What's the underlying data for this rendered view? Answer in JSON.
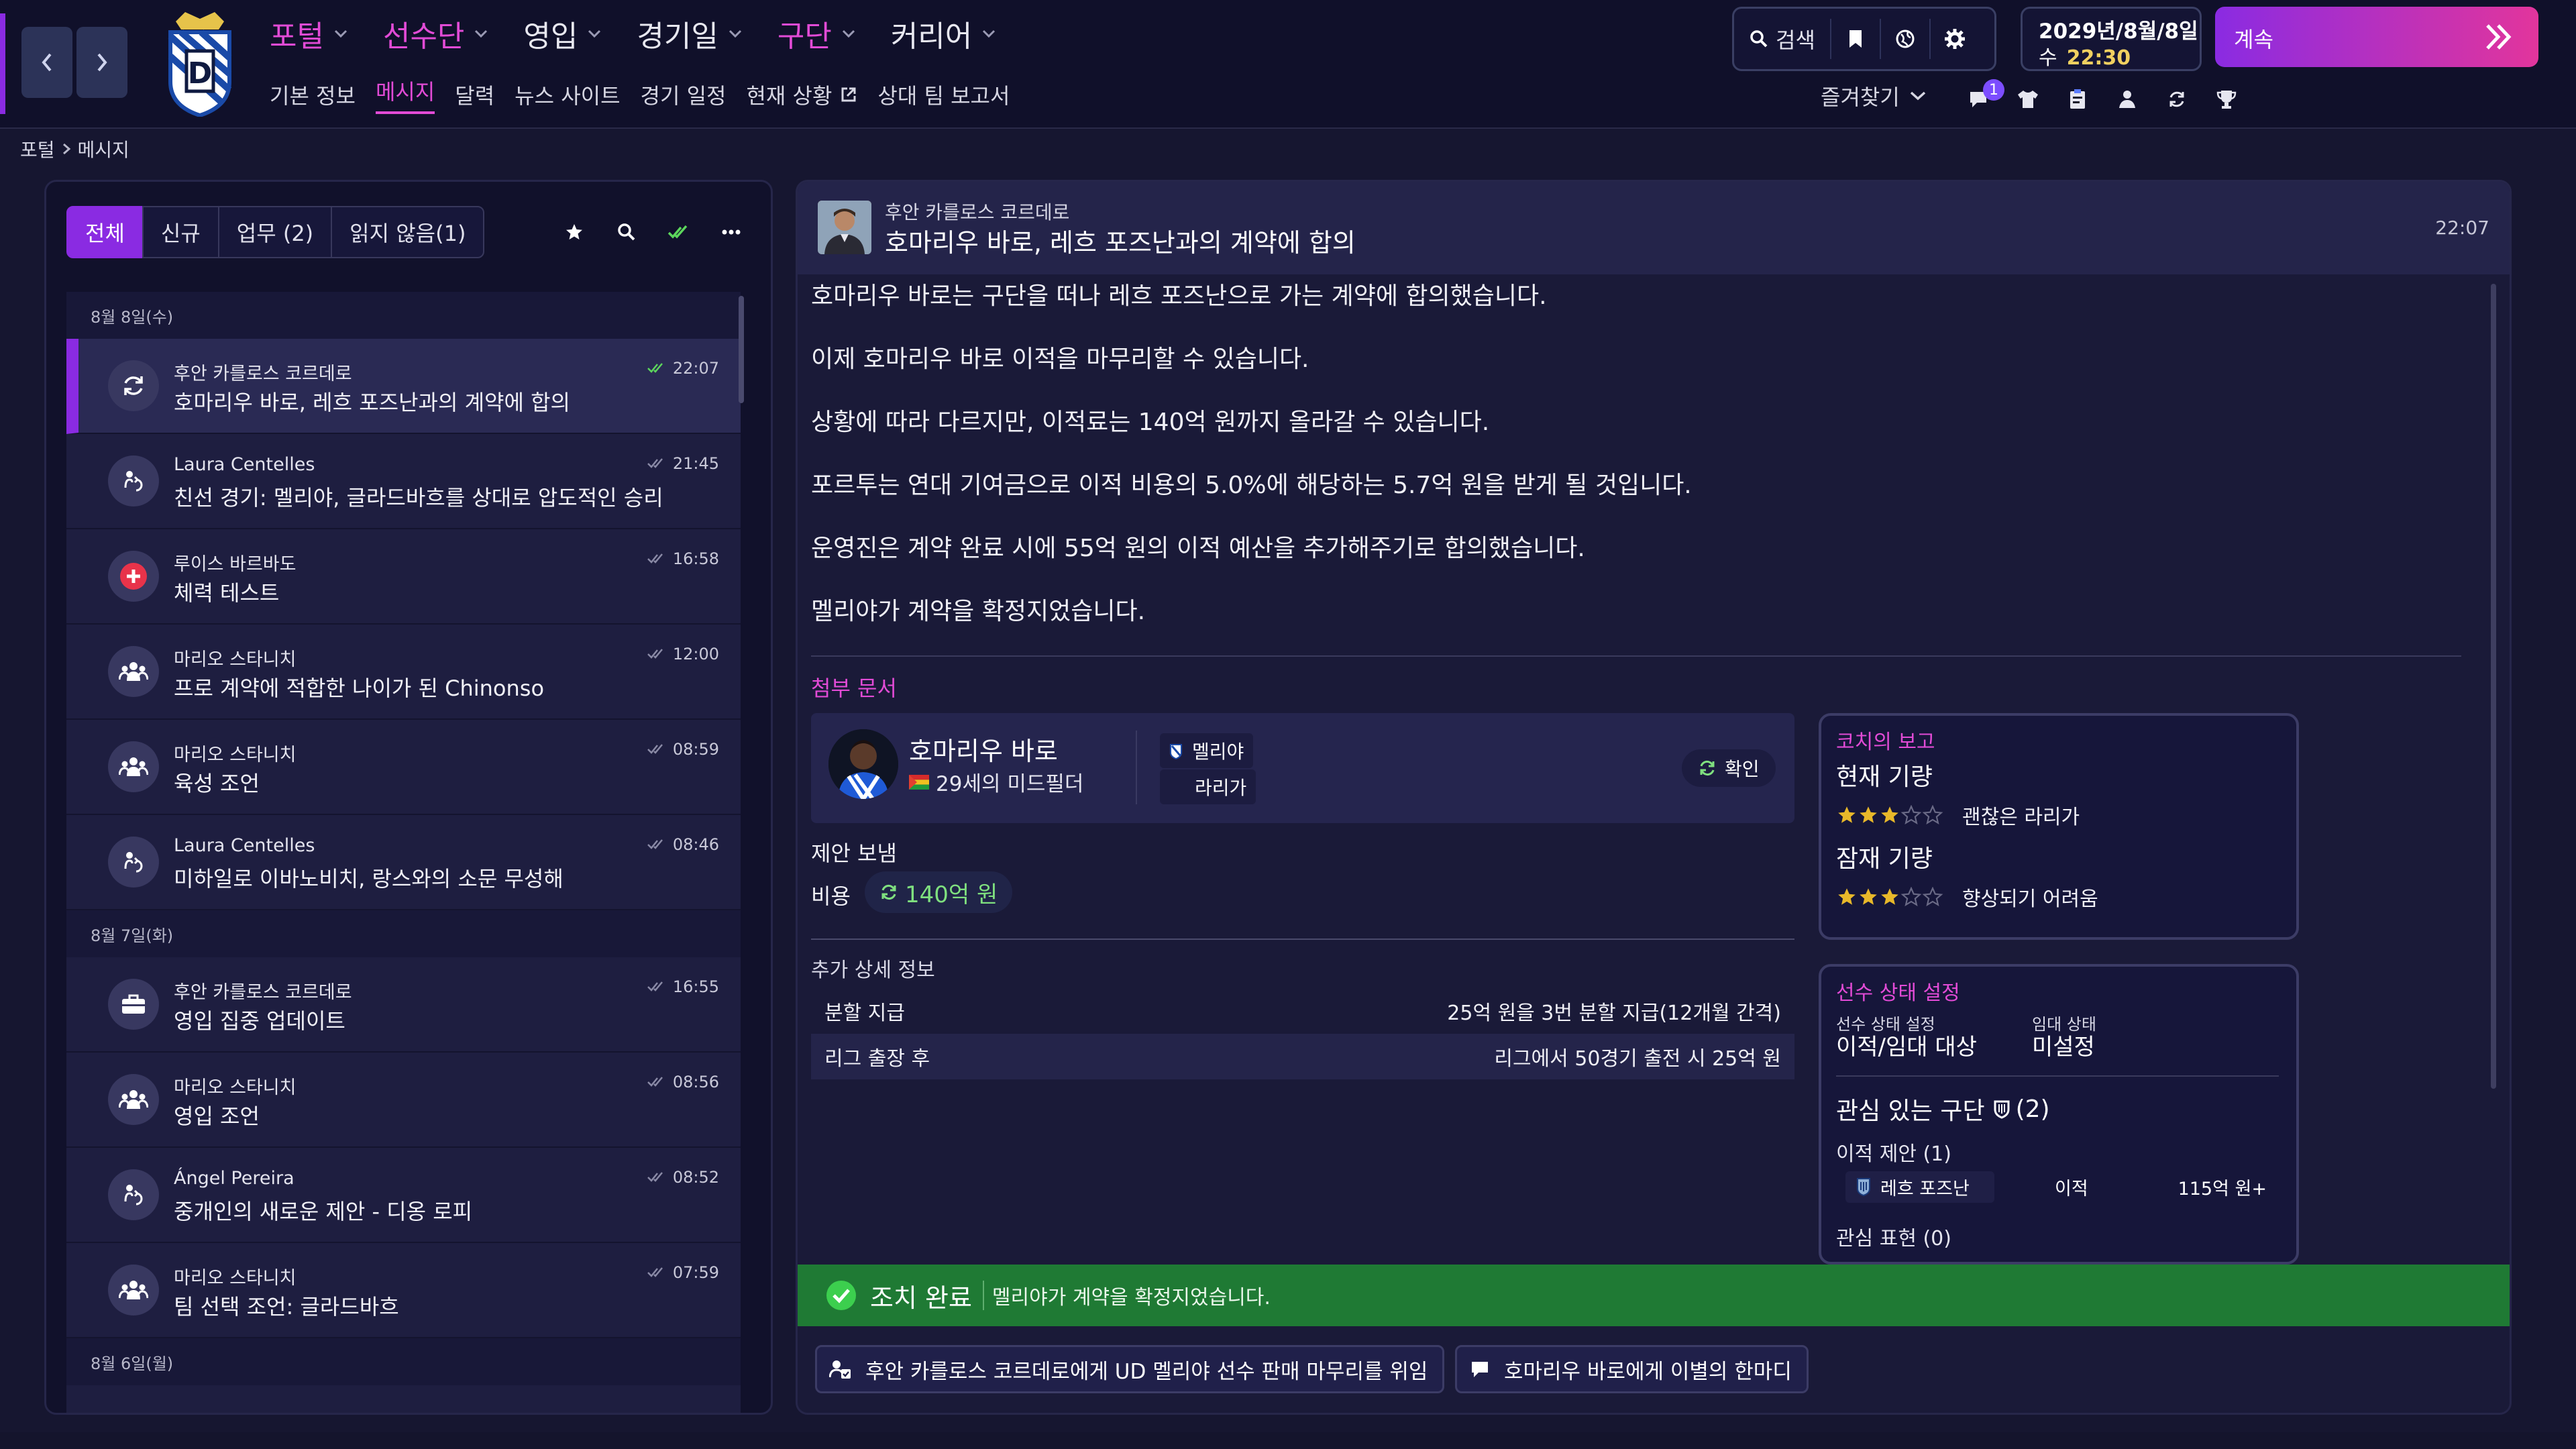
{
  "accent": "#8a2be2",
  "highlight": "#e24bd6",
  "success": "#1f7a34",
  "nav": {
    "main": [
      {
        "label": "포털",
        "highlight": true
      },
      {
        "label": "선수단",
        "highlight": true
      },
      {
        "label": "영입",
        "highlight": false
      },
      {
        "label": "경기일",
        "highlight": false
      },
      {
        "label": "구단",
        "highlight": true
      },
      {
        "label": "커리어",
        "highlight": false
      }
    ],
    "sub": [
      "기본 정보",
      "메시지",
      "달력",
      "뉴스 사이트",
      "경기 일정",
      "현재 상황",
      "상대 팀 보고서"
    ],
    "sub_active": "메시지"
  },
  "toolbar": {
    "search_label": "검색",
    "date_line": "2029년/8월/8일",
    "day": "수",
    "time": "22:30",
    "continue_label": "계속",
    "favorites_label": "즐겨찾기",
    "notification_count": "1"
  },
  "breadcrumb": {
    "root": "포털",
    "current": "메시지"
  },
  "inbox": {
    "filters": [
      "전체",
      "신규",
      "업무 (2)",
      "읽지 않음(1)"
    ],
    "groups": [
      {
        "date": "8월 8일(수)",
        "messages": [
          {
            "from": "후안 카를로스 코르데로",
            "subject": "호마리우 바로, 레흐 포즈난과의 계약에 합의",
            "time": "22:07",
            "icon": "refresh-icon",
            "selected": true
          },
          {
            "from": "Laura Centelles",
            "subject": "친선 경기: 멜리야, 글라드바흐를 상대로 압도적인 승리",
            "time": "21:45",
            "icon": "staff-icon",
            "selected": false
          },
          {
            "from": "루이스 바르바도",
            "subject": "체력 테스트",
            "time": "16:58",
            "icon": "medical-icon",
            "selected": false
          },
          {
            "from": "마리오 스타니치",
            "subject": "프로 계약에 적합한 나이가 된 Chinonso",
            "time": "12:00",
            "icon": "youth-icon",
            "selected": false
          },
          {
            "from": "마리오 스타니치",
            "subject": "육성 조언",
            "time": "08:59",
            "icon": "youth-icon",
            "selected": false
          },
          {
            "from": "Laura Centelles",
            "subject": "미하일로 이바노비치, 랑스와의 소문 무성해",
            "time": "08:46",
            "icon": "staff-icon",
            "selected": false
          }
        ]
      },
      {
        "date": "8월 7일(화)",
        "messages": [
          {
            "from": "후안 카를로스 코르데로",
            "subject": "영입 집중 업데이트",
            "time": "16:55",
            "icon": "briefcase-icon",
            "selected": false
          },
          {
            "from": "마리오 스타니치",
            "subject": "영입 조언",
            "time": "08:56",
            "icon": "youth-icon",
            "selected": false
          },
          {
            "from": "Ángel Pereira",
            "subject": "중개인의 새로운 제안 - 디옹 로피",
            "time": "08:52",
            "icon": "staff-icon",
            "selected": false
          },
          {
            "from": "마리오 스타니치",
            "subject": "팀 선택 조언: 글라드바흐",
            "time": "07:59",
            "icon": "youth-icon",
            "selected": false
          }
        ]
      },
      {
        "date": "8월 6일(월)",
        "messages": []
      }
    ]
  },
  "message": {
    "from": "후안 카를로스 코르데로",
    "title": "호마리우 바로, 레흐 포즈난과의 계약에 합의",
    "time": "22:07",
    "paragraphs": [
      "호마리우 바로는 구단을 떠나 레흐 포즈난으로 가는 계약에 합의했습니다.",
      "이제 호마리우 바로 이적을 마무리할 수 있습니다.",
      "상황에 따라 다르지만, 이적료는 140억 원까지 올라갈 수 있습니다.",
      "포르투는 연대 기여금으로 이적 비용의 5.0%에 해당하는 5.7억 원을 받게 될 것입니다.",
      "운영진은 계약 완료 시에 55억 원의 이적 예산을 추가해주기로 합의했습니다.",
      "멜리야가 계약을 확정지었습니다."
    ],
    "attachments_label": "첨부 문서",
    "player": {
      "name": "호마리우 바로",
      "desc": "29세의 미드필더",
      "club": "멜리야",
      "league": "라리가",
      "confirm_label": "확인"
    },
    "offer_label": "제안 보냄",
    "fee_label": "비용",
    "fee_value": "140억 원",
    "additional_label": "추가 상세 정보",
    "details": [
      {
        "label": "분할 지급",
        "value": "25억 원을 3번 분할 지급(12개월 간격)"
      },
      {
        "label": "리그 출장 후",
        "value": "리그에서 50경기 출전 시 25억 원"
      }
    ],
    "coach_report": {
      "title": "코치의 보고",
      "current_label": "현재 기량",
      "current_stars": 3,
      "current_text": "괜찮은 라리가",
      "potential_label": "잠재 기량",
      "potential_stars": 3,
      "potential_text": "향상되기 어려움"
    },
    "player_status": {
      "title": "선수 상태 설정",
      "status_label": "선수 상태 설정",
      "status_value": "이적/임대 대상",
      "loan_label": "임대 상태",
      "loan_value": "미설정",
      "interested_label": "관심 있는 구단",
      "interested_count": "(2)",
      "transfer_offers_label": "이적 제안 (1)",
      "offer_club": "레흐 포즈난",
      "offer_type": "이적",
      "offer_amount": "115억 원+",
      "interest_label": "관심 표현 (0)"
    },
    "done": {
      "label": "조치 완료",
      "text": "멜리야가 계약을 확정지었습니다."
    },
    "actions": [
      "후안 카를로스 코르데로에게 UD 멜리야 선수 판매 마무리를 위임",
      "호마리우 바로에게 이별의 한마디"
    ]
  }
}
